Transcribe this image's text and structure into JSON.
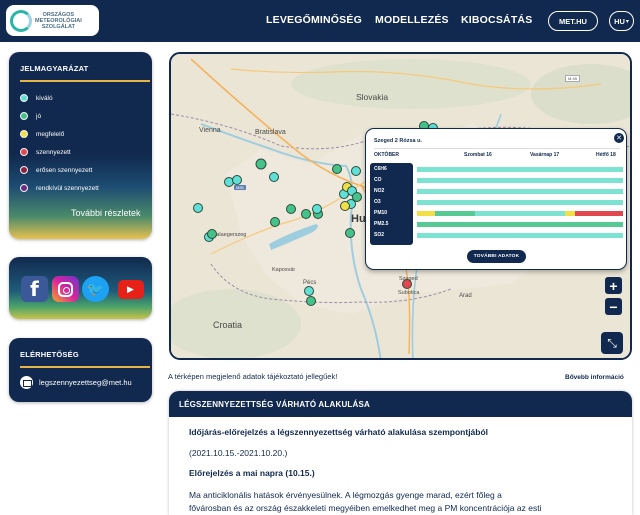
{
  "header": {
    "logo_text": "ORSZÁGOS\nMETEOROLÓGIAI\nSZOLGÁLAT",
    "nav": [
      "LEVEGŐMINŐSÉG",
      "MODELLEZÉS",
      "KIBOCSÁTÁS"
    ],
    "met_label": "MET.HU",
    "lang_label": "HU",
    "lang_caret": "▾"
  },
  "legend": {
    "title": "JELMAGYARÁZAT",
    "items": [
      {
        "label": "kiváló",
        "color": "#5ee0d6"
      },
      {
        "label": "jó",
        "color": "#44c28a"
      },
      {
        "label": "megfelelő",
        "color": "#f0df45"
      },
      {
        "label": "szennyezett",
        "color": "#e0474f"
      },
      {
        "label": "erősen szennyezett",
        "color": "#8e1f3f"
      },
      {
        "label": "rendkívül szennyezett",
        "color": "#6e2b86"
      }
    ],
    "more_label": "További részletek"
  },
  "social": {
    "facebook_glyph": "f",
    "twitter_glyph": "🐦",
    "youtube_glyph": "▶"
  },
  "contact": {
    "title": "ELÉRHETŐSÉG",
    "email": "legszennyezettseg@met.hu"
  },
  "map": {
    "labels": {
      "slovakia": "Slovakia",
      "vienna": "Vienna",
      "bratislava": "Bratislava",
      "zalaegerszeg": "Zalaegerszeg",
      "kaposvar": "Kaposvár",
      "pecs": "Pécs",
      "subotica": "Subotica",
      "arad": "Arad",
      "croatia": "Croatia",
      "hu": "Hu",
      "szeged": "Szeged"
    },
    "zoom_in": "+",
    "zoom_out": "−",
    "fullscreen": "⤡"
  },
  "popup": {
    "title": "Szeged 2 Rózsa u.",
    "close": "✕",
    "days": [
      "OKTÓBER",
      "Szombat 16",
      "Vasárnap 17",
      "Hétfő 18"
    ],
    "pollutants": [
      "C6H6",
      "CO",
      "NO2",
      "O3",
      "PM10",
      "PM2.5",
      "SO2"
    ],
    "button": "TOVÁBBI ADATOK"
  },
  "disclaimer": "A térképen megjelenő adatok tájékoztató jellegűek!",
  "more_info": "Bővebb információ",
  "forecast": {
    "title": "LÉGSZENNYEZETTSÉG VÁRHATÓ ALAKULÁSA",
    "subtitle": "Időjárás-előrejelzés a légszennyezettség várható alakulása szempontjából",
    "date_range": "(2021.10.15.-2021.10.20.)",
    "today_heading": "Előrejelzés a mai napra (10.15.)",
    "paragraph_1": "Ma anticiklonális hatások érvényesülnek. A légmozgás gyenge marad, ezért főleg a",
    "paragraph_2": "fővárosban és az ország északkeleti megyéiben emelkedhet meg a PM koncentrációja az esti"
  }
}
